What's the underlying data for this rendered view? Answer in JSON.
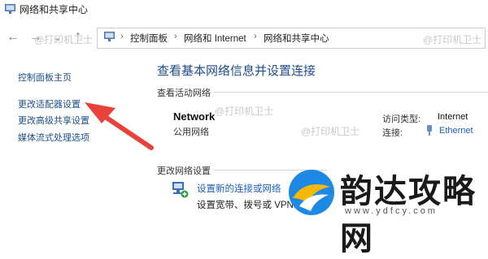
{
  "window": {
    "title": "网络和共享中心"
  },
  "nav": {
    "back_icon": "arrow-left-icon",
    "forward_icon": "arrow-right-icon",
    "history_icon": "chevron-down-icon",
    "up_icon": "arrow-up-icon"
  },
  "breadcrumb": [
    "控制面板",
    "网络和 Internet",
    "网络和共享中心"
  ],
  "sidebar": {
    "items": [
      "控制面板主页",
      "更改适配器设置",
      "更改高级共享设置",
      "媒体流式处理选项"
    ]
  },
  "main": {
    "title": "查看基本网络信息并设置连接",
    "active_networks_label": "查看活动网络",
    "network_name": "Network",
    "network_type": "公用网络",
    "access_type_label": "访问类型:",
    "access_type_value": "Internet",
    "connections_label": "连接:",
    "connections_value": "Ethernet",
    "change_settings_label": "更改网络设置",
    "new_connection_link": "设置新的连接或网络",
    "new_connection_desc": "设置宽带、拨号或 VPN"
  },
  "watermarks": [
    "@打印机卫士",
    "@打印机卫士",
    "@打印机卫士",
    "@打印机卫士"
  ],
  "logo": {
    "text": "韵达攻略网",
    "url": "www.ydfcy.com"
  },
  "colors": {
    "annotation_arrow": "#e8423b",
    "link": "#1d5fb8",
    "title": "#1f4e8c"
  }
}
